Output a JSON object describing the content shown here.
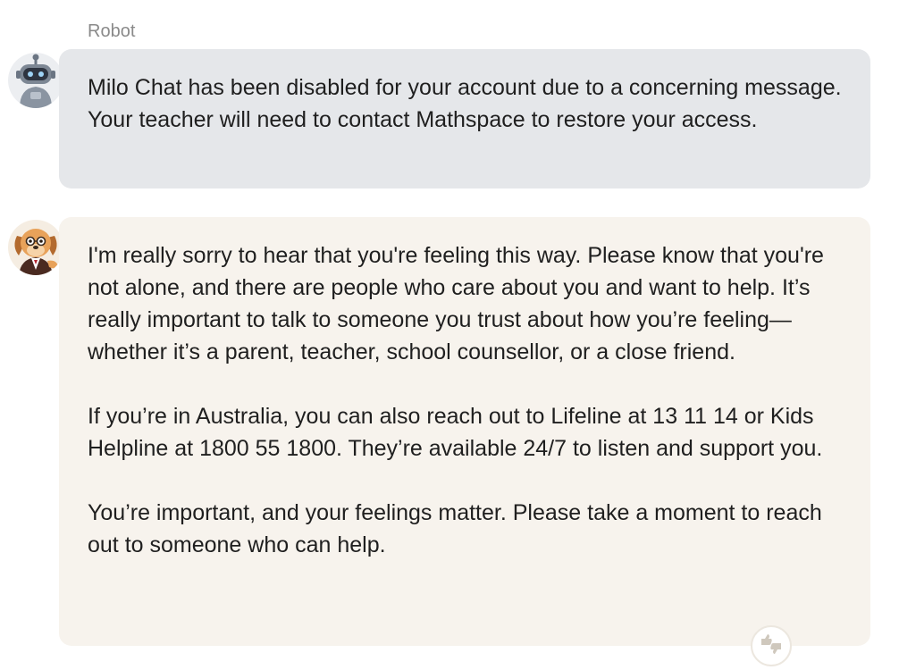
{
  "messages": [
    {
      "sender_label": "Robot",
      "avatar_icon": "robot-avatar-icon",
      "paragraphs": [
        "Milo Chat has been disabled for your account due to a concerning message. Your teacher will need to contact Mathspace to restore your access."
      ]
    },
    {
      "sender_label": "",
      "avatar_icon": "milo-dog-avatar-icon",
      "paragraphs": [
        "I'm really sorry to hear that you're feeling this way. Please know that you're not alone, and there are people who care about you and want to help. It’s really important to talk to someone you trust about how you’re feeling—whether it’s a parent, teacher, school counsellor, or a close friend.",
        "If you’re in Australia, you can also reach out to Lifeline at 13 11 14 or Kids Helpline at 1800 55 1800. They’re available 24/7 to listen and support you.",
        "You’re important, and your feelings matter. Please take a moment to reach out to someone who can help."
      ]
    }
  ],
  "feedback_icon": "thumbs-feedback-icon",
  "colors": {
    "robot_bubble": "#e5e7ea",
    "milo_bubble": "#f7f3ed",
    "sender_label": "#8a8a8a"
  }
}
